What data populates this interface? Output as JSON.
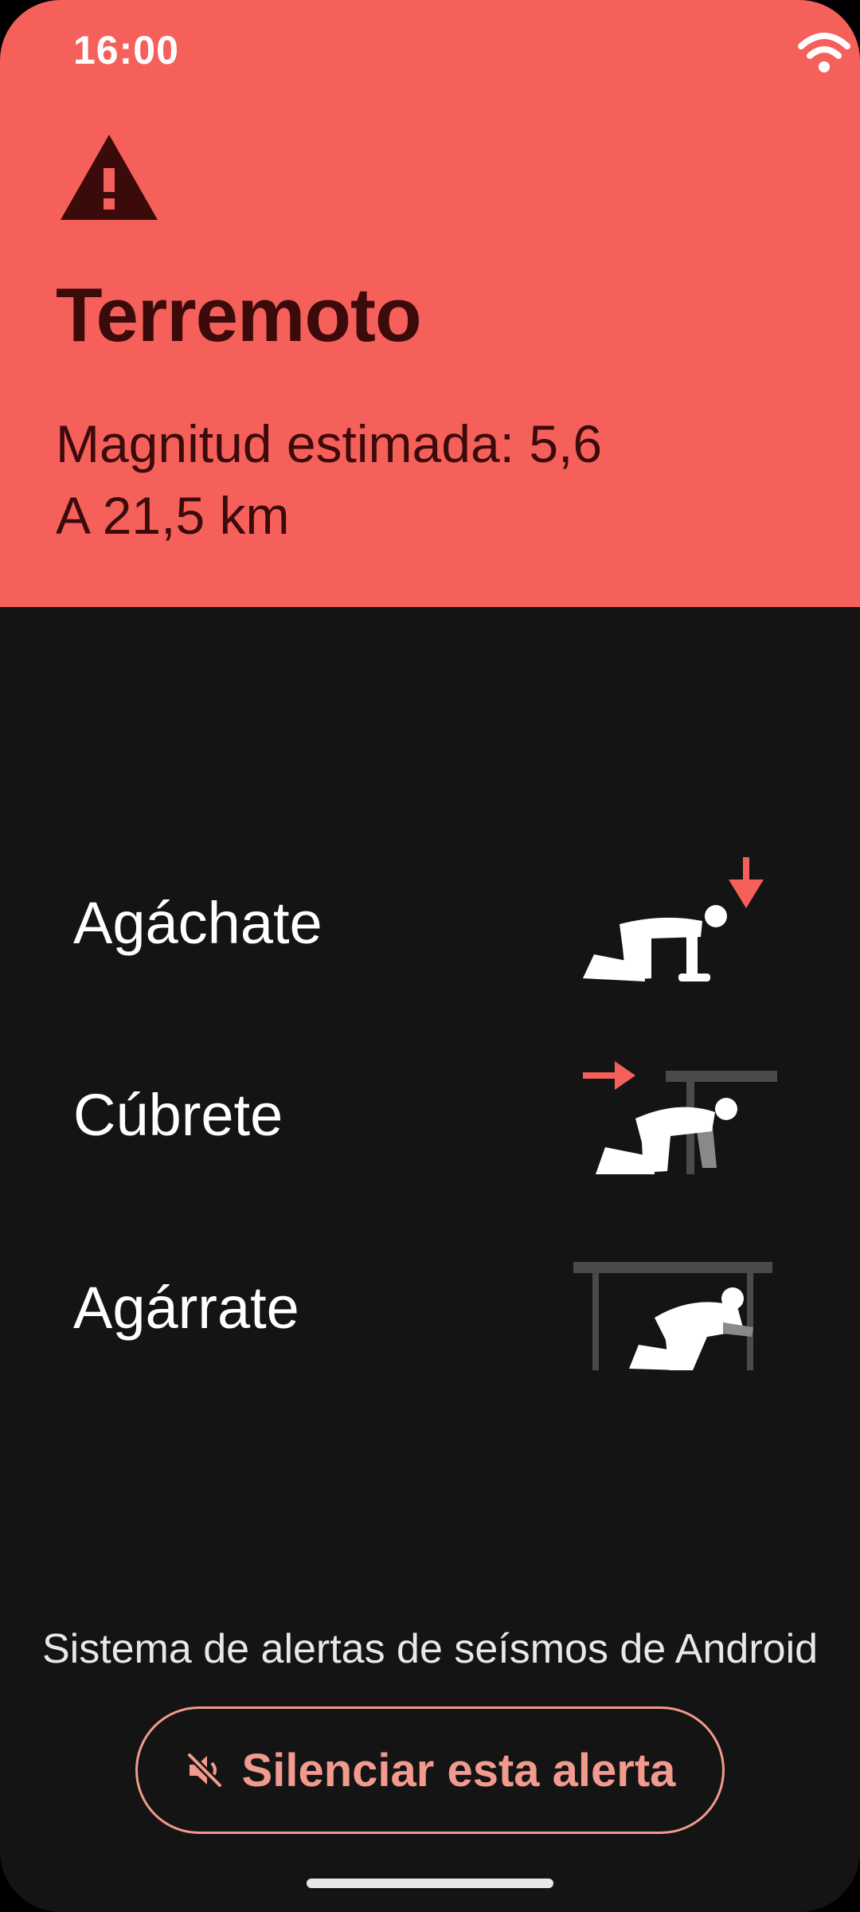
{
  "status_bar": {
    "time": "16:00",
    "icons": [
      "wifi-icon",
      "battery-charging-icon"
    ]
  },
  "alert": {
    "icon": "warning-triangle-icon",
    "title": "Terremoto",
    "magnitude": "Magnitud estimada: 5,6",
    "distance": "A 21,5 km"
  },
  "steps": [
    {
      "label": "Agáchate",
      "illustration": "drop-illustration"
    },
    {
      "label": "Cúbrete",
      "illustration": "cover-illustration"
    },
    {
      "label": "Agárrate",
      "illustration": "hold-on-illustration"
    }
  ],
  "footer": {
    "system_label": "Sistema de alertas de seísmos de Android",
    "mute_button": {
      "icon": "volume-off-icon",
      "label": "Silenciar esta alerta"
    }
  },
  "colors": {
    "header_bg": "#f6605a",
    "body_bg": "#141414",
    "header_text": "#3b0a0a",
    "accent": "#f29a8e",
    "battery": "#22c55e"
  }
}
